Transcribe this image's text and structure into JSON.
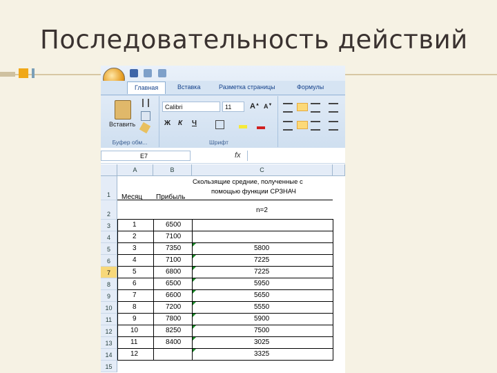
{
  "slide": {
    "title": "Последовательность действий"
  },
  "excel": {
    "tabs": [
      "Главная",
      "Вставка",
      "Разметка страницы",
      "Формулы"
    ],
    "clipboard": {
      "paste_label": "Вставить",
      "group_label": "Буфер обм..."
    },
    "font": {
      "name": "Calibri",
      "size": "11",
      "group_label": "Шрифт",
      "bold": "Ж",
      "italic": "К",
      "underline": "Ч"
    },
    "name_box": "E7",
    "fx_label": "fx",
    "columns": [
      "A",
      "B",
      "C"
    ],
    "header": {
      "col_a": "Месяц",
      "col_b": "Прибыль",
      "col_c_line1": "Скользящие средние, полученные с",
      "col_c_line2": "помощью функции СРЗНАЧ",
      "n_label": "n=2"
    },
    "row_numbers": [
      "1",
      "2",
      "3",
      "4",
      "5",
      "6",
      "7",
      "8",
      "9",
      "10",
      "11",
      "12",
      "13",
      "14",
      "15"
    ],
    "selected_row": "7",
    "rows": [
      {
        "month": "1",
        "profit": "6500",
        "avg": ""
      },
      {
        "month": "2",
        "profit": "7100",
        "avg": ""
      },
      {
        "month": "3",
        "profit": "7350",
        "avg": "5800"
      },
      {
        "month": "4",
        "profit": "7100",
        "avg": "7225"
      },
      {
        "month": "5",
        "profit": "6800",
        "avg": "7225"
      },
      {
        "month": "6",
        "profit": "6500",
        "avg": "5950"
      },
      {
        "month": "7",
        "profit": "6600",
        "avg": "5650"
      },
      {
        "month": "8",
        "profit": "7200",
        "avg": "5550"
      },
      {
        "month": "9",
        "profit": "7800",
        "avg": "5900"
      },
      {
        "month": "10",
        "profit": "8250",
        "avg": "7500"
      },
      {
        "month": "11",
        "profit": "8400",
        "avg": "3025"
      },
      {
        "month": "12",
        "profit": "",
        "avg": "3325"
      }
    ]
  }
}
